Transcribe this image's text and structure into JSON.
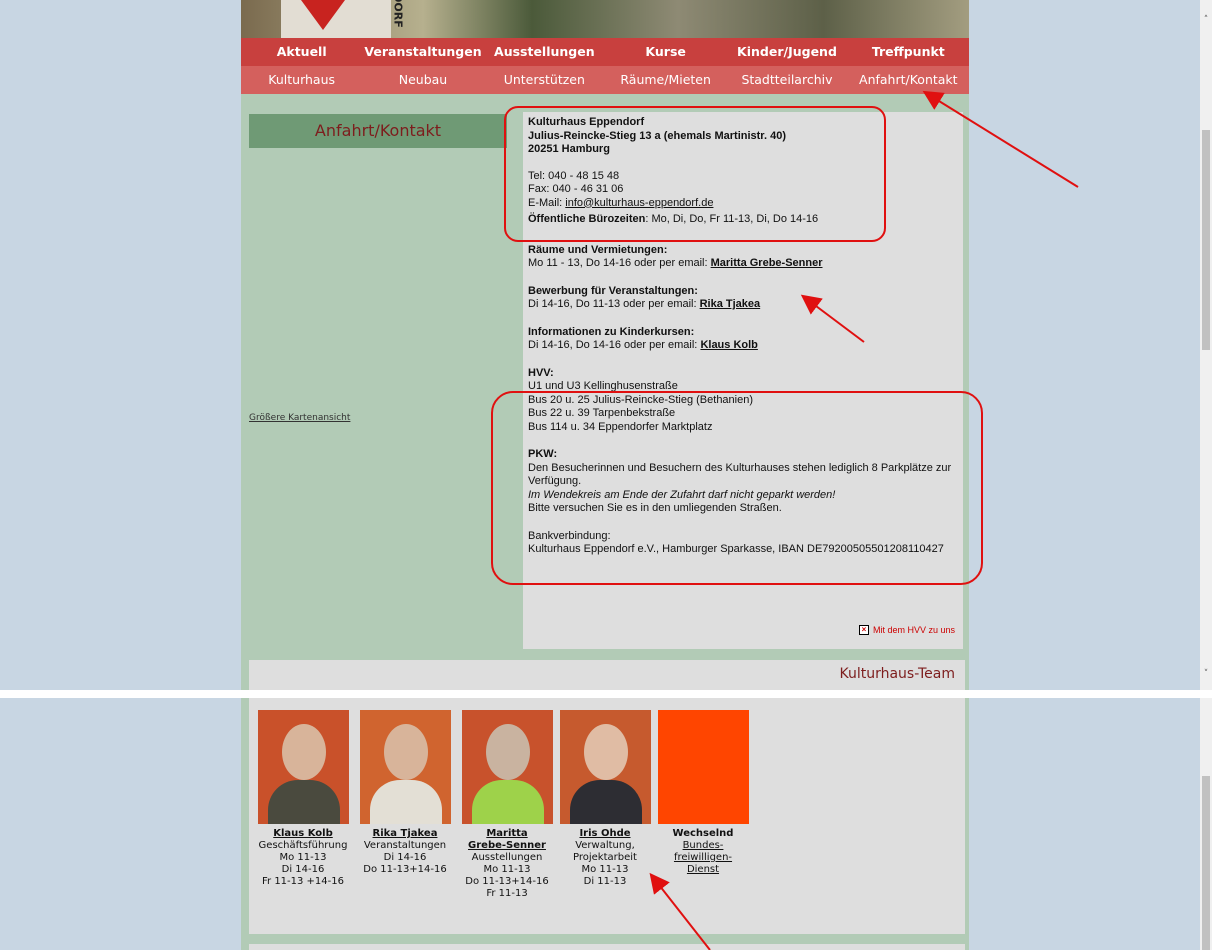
{
  "logo": {
    "text": "DORF"
  },
  "nav": {
    "row1": [
      "Aktuell",
      "Veranstaltungen",
      "Ausstellungen",
      "Kurse",
      "Kinder/Jugend",
      "Treffpunkt"
    ],
    "row2": [
      "Kulturhaus",
      "Neubau",
      "Unterstützen",
      "Räume/Mieten",
      "Stadtteilarchiv",
      "Anfahrt/Kontakt"
    ]
  },
  "sidebar": {
    "title": "Anfahrt/Kontakt",
    "map_link": "Größere Kartenansicht"
  },
  "contact": {
    "org": "Kulturhaus Eppendorf",
    "street": "Julius-Reincke-Stieg 13 a (ehemals Martinistr. 40)",
    "city": "20251 Hamburg",
    "tel": "Tel: 040 - 48 15 48",
    "fax": "Fax: 040 - 46 31 06",
    "email_label": "E-Mail: ",
    "email": "info@kulturhaus-eppendorf.de",
    "office_label": "Öffentliche Bürozeiten",
    "office_hours": ": Mo, Di, Do, Fr 11-13, Di, Do 14-16",
    "rooms_title": "Räume und Vermietungen:",
    "rooms_text": "Mo 11 - 13, Do 14-16 oder per email: ",
    "rooms_contact": "Maritta Grebe-Senner",
    "events_title": "Bewerbung für Veranstaltungen:",
    "events_text": "Di 14-16, Do 11-13 oder per email: ",
    "events_contact": "Rika Tjakea",
    "kids_title": "Informationen zu Kinderkursen:",
    "kids_text": "Di 14-16, Do 14-16 oder per email: ",
    "kids_contact": "Klaus Kolb",
    "hvv_title": "HVV:",
    "hvv_lines": [
      "U1 und U3 Kellinghusenstraße",
      "Bus 20 u. 25 Julius-Reincke-Stieg (Bethanien)",
      "Bus 22 u. 39 Tarpenbekstraße",
      "Bus 114 u. 34 Eppendorfer Marktplatz"
    ],
    "pkw_title": "PKW:",
    "pkw_text": "Den Besucherinnen und Besuchern des Kulturhauses stehen lediglich 8 Parkplätze zur Verfügung.",
    "pkw_italic": "Im Wendekreis am Ende der Zufahrt darf nicht geparkt werden!",
    "pkw_hint": "Bitte versuchen Sie es in den umliegenden Straßen.",
    "bank_title": "Bankverbindung:",
    "bank_text": "Kulturhaus Eppendorf e.V., Hamburger Sparkasse, IBAN DE79200505501208110427",
    "hvv_link": "Mit dem HVV zu uns"
  },
  "team": {
    "title": "Kulturhaus-Team",
    "members": [
      {
        "name": "Klaus Kolb",
        "lines": [
          "Geschäftsführung",
          "Mo 11-13",
          "Di 14-16",
          "Fr 11-13 +14-16"
        ],
        "photo_bg": "#c9512a",
        "shirt": "#4a4a3e",
        "linked": true
      },
      {
        "name": "Rika Tjakea",
        "lines": [
          "Veranstaltungen",
          "Di 14-16",
          "Do 11-13+14-16"
        ],
        "photo_bg": "#d0642f",
        "shirt": "#e3dfd5",
        "linked": true
      },
      {
        "name": "Maritta Grebe-Senner",
        "name_lines": [
          "Maritta",
          "Grebe-Senner"
        ],
        "lines": [
          "Ausstellungen",
          "Mo 11-13",
          "Do 11-13+14-16",
          "Fr 11-13"
        ],
        "photo_bg": "#c8522c",
        "shirt": "#9ed24a",
        "linked": true
      },
      {
        "name": "Iris Ohde",
        "lines": [
          "Verwaltung,",
          "Projektarbeit",
          "Mo 11-13",
          "Di 11-13"
        ],
        "photo_bg": "#c65a2e",
        "shirt": "#2d2d33",
        "linked": true
      },
      {
        "name": "Wechselnd",
        "link_lines": [
          "Bundes-",
          "freiwilligen-",
          "Dienst"
        ],
        "photo_bg": "#ff4500",
        "linked": false
      }
    ]
  },
  "colors": {
    "nav_row1": "#c8403e",
    "nav_row2": "#d4605d",
    "page_bg": "#b2cbb6",
    "accent_text": "#7d1d1d",
    "annotation": "#e01010"
  }
}
